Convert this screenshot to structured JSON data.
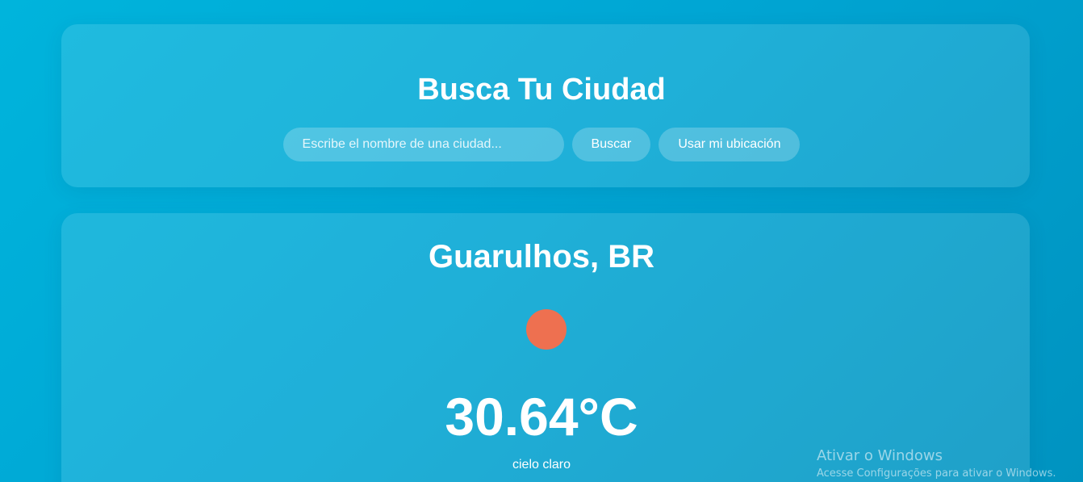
{
  "search": {
    "title": "Busca Tu Ciudad",
    "input_value": "",
    "placeholder": "Escribe el nombre de una ciudad...",
    "search_button": "Buscar",
    "location_button": "Usar mi ubicación"
  },
  "weather": {
    "city": "Guarulhos, BR",
    "icon": "sun-icon",
    "icon_color": "#ee7050",
    "temperature": "30.64°C",
    "description": "cielo claro"
  },
  "os_watermark": {
    "title": "Ativar o Windows",
    "subtitle": "Acesse Configurações para ativar o Windows."
  }
}
